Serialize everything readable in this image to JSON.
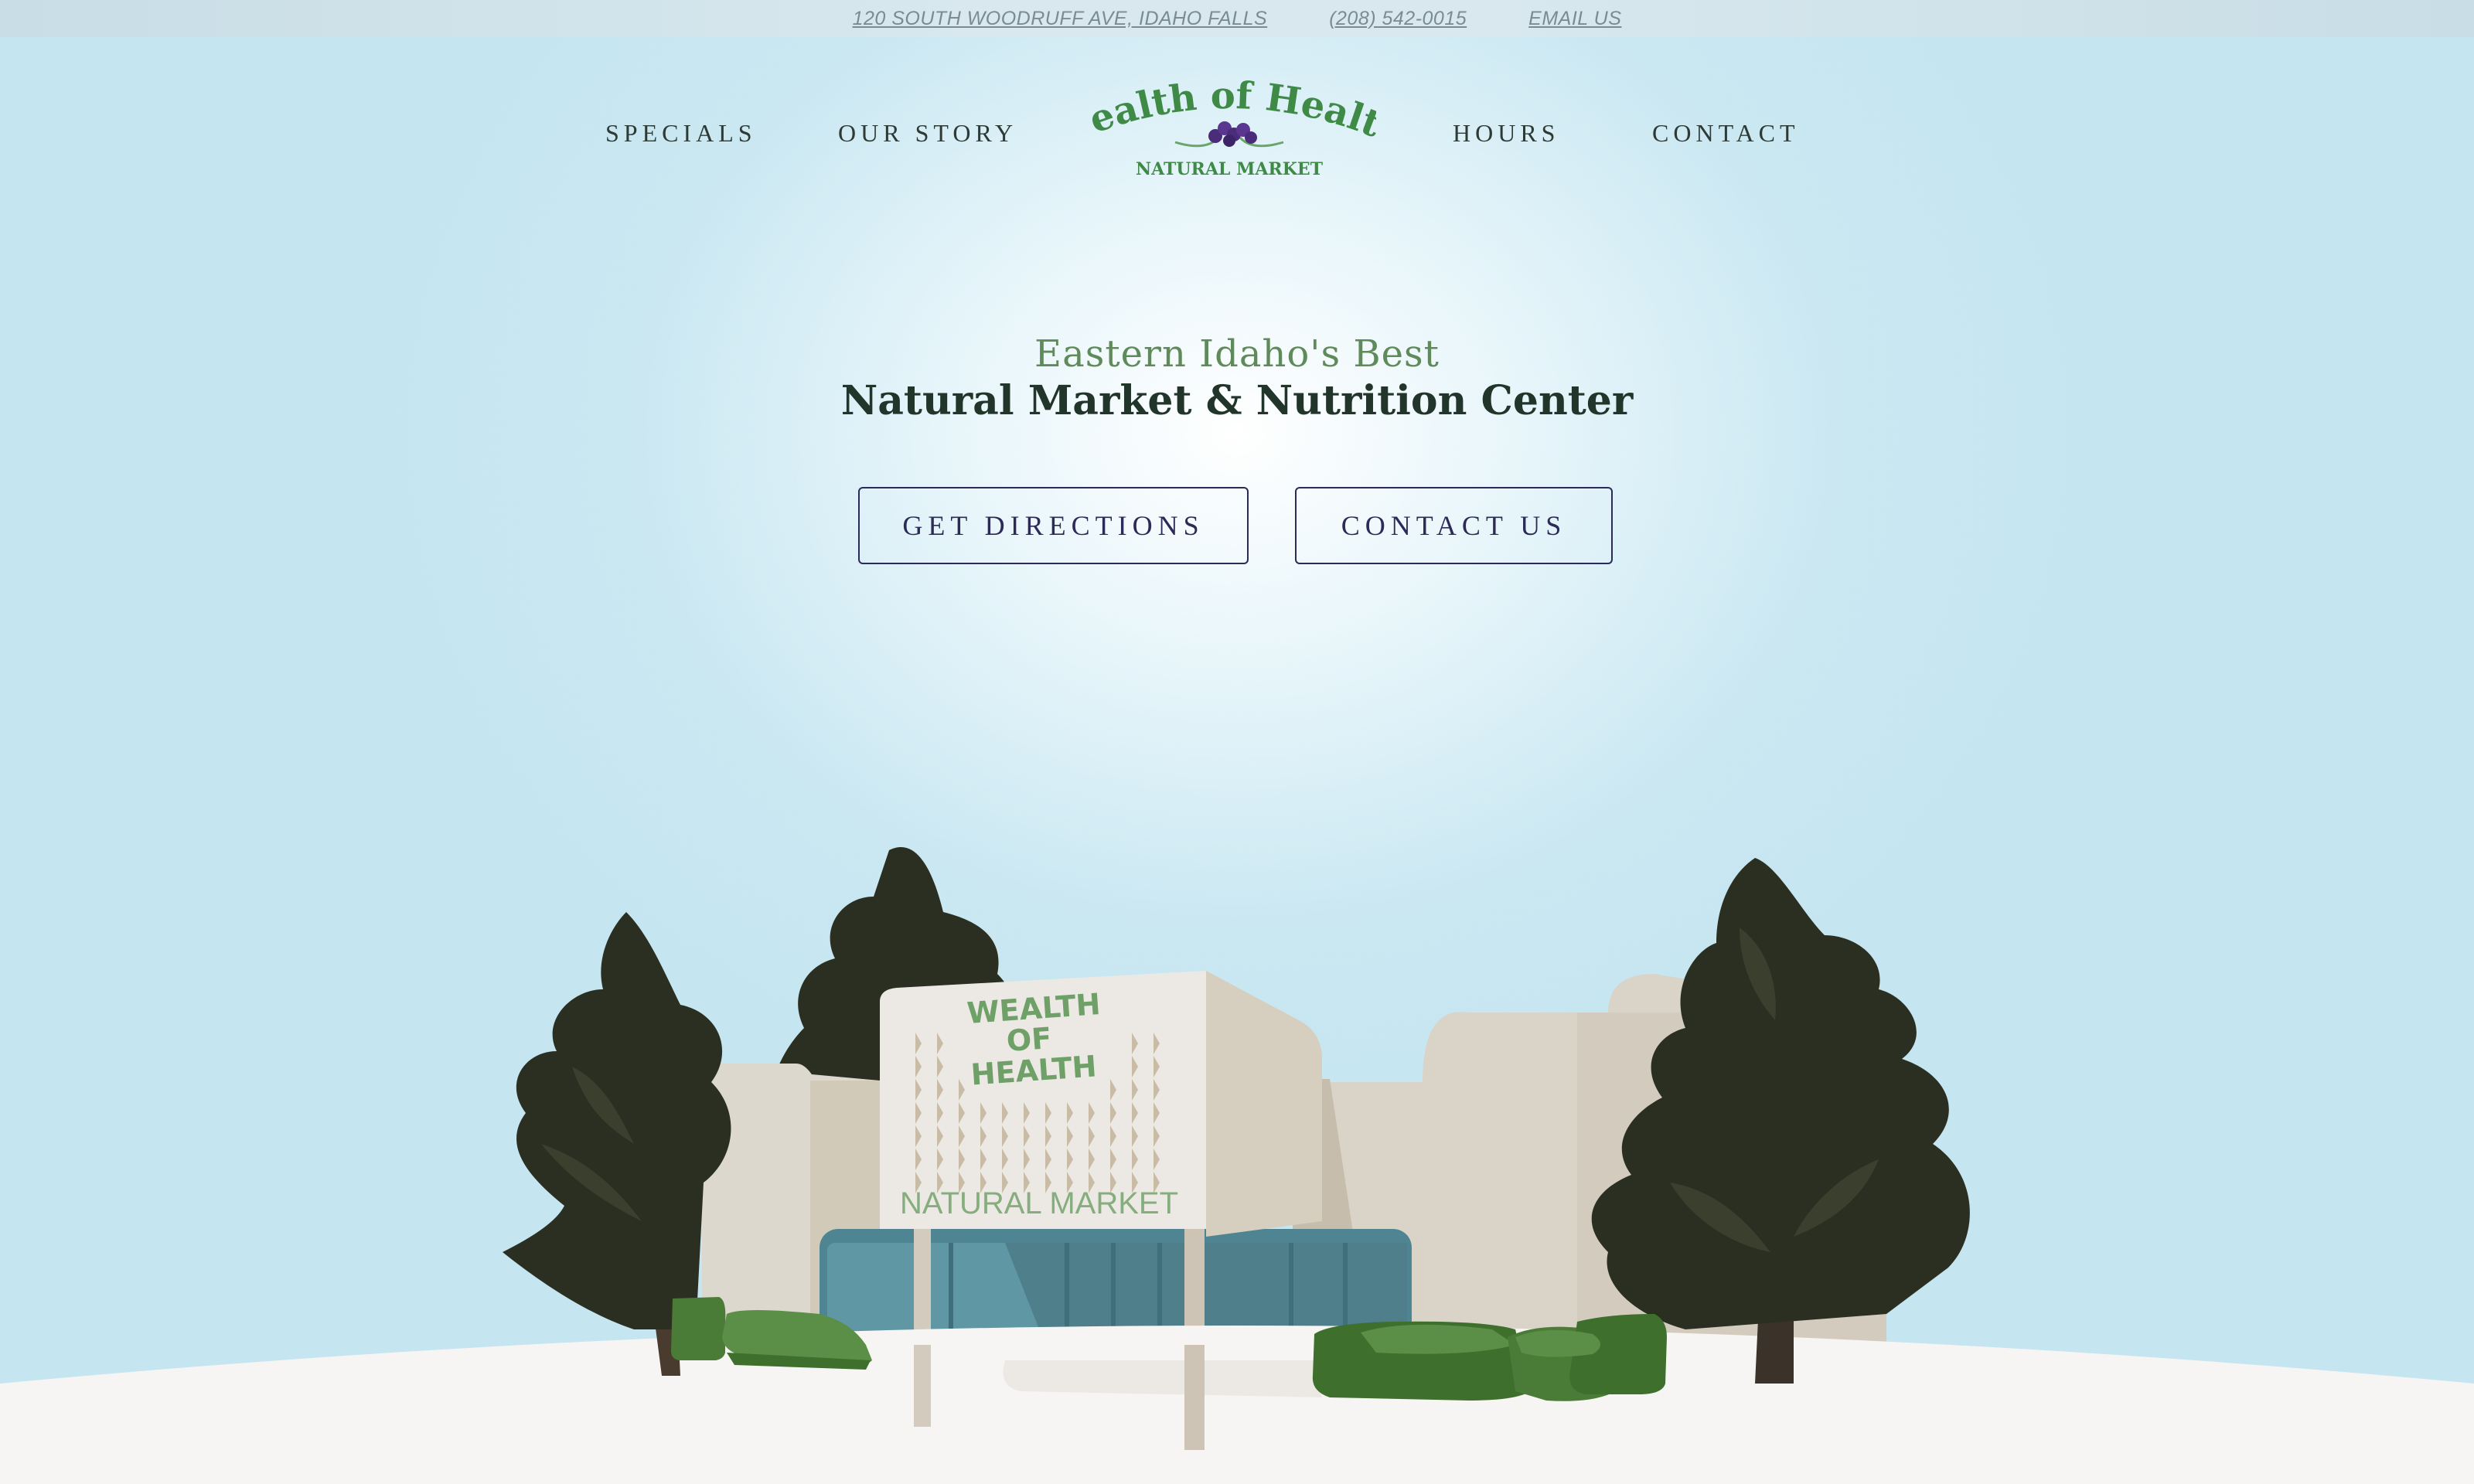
{
  "topbar": {
    "address": "120 SOUTH WOODRUFF AVE, IDAHO FALLS",
    "phone": "(208) 542-0015",
    "email": "EMAIL US"
  },
  "nav": {
    "specials": "SPECIALS",
    "our_story": "OUR STORY",
    "hours": "HOURS",
    "contact": "CONTACT"
  },
  "logo": {
    "brand": "Wealth of Health",
    "tagline": "NATURAL MARKET"
  },
  "hero": {
    "subtitle": "Eastern Idaho's Best",
    "title": "Natural Market & Nutrition Center"
  },
  "buttons": {
    "directions": "GET DIRECTIONS",
    "contact": "CONTACT US"
  },
  "building_sign": {
    "line1": "WEALTH",
    "line2": "OF",
    "line3": "HEALTH",
    "subtitle": "NATURAL MARKET"
  },
  "colors": {
    "brand_green": "#3f8a46",
    "violet": "#4a2c7a",
    "button_border": "#2c2a56",
    "sky": "#c5e5f0",
    "ground": "#f6f5f3"
  }
}
